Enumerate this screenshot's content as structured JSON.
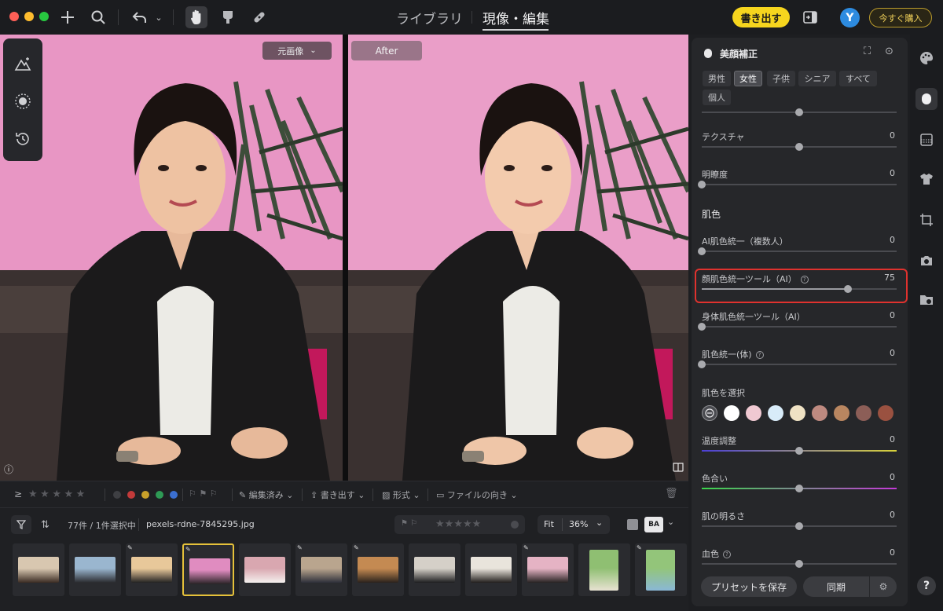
{
  "toolbar": {
    "tabs": [
      {
        "label": "ライブラリ",
        "active": false
      },
      {
        "label": "現像・編集",
        "active": true
      }
    ],
    "export_label": "書き出す",
    "avatar_initial": "Y",
    "buy_label": "今すぐ購入",
    "accent_color": "#f6d51e"
  },
  "viewer": {
    "before_label": "元画像",
    "after_label": "After"
  },
  "filmstrip": {
    "filter_items": {
      "edited": "編集済み",
      "export": "書き出す",
      "format": "形式",
      "orientation": "ファイルの向き"
    },
    "count_text": "77件 / 1件選択中",
    "filename": "pexels-rdne-7845295.jpg",
    "fit_label": "Fit",
    "zoom_value": "36%",
    "compare_label": "BA",
    "color_labels": [
      "#3e3f43",
      "#c23a3a",
      "#c8a02a",
      "#2e9a55",
      "#3b6fd0"
    ],
    "thumbnails": [
      {
        "colors": [
          "#d8c7b0",
          "#3a2b22"
        ],
        "portrait": false,
        "edited": false,
        "selected": false
      },
      {
        "colors": [
          "#9ab6cf",
          "#2a2a2e"
        ],
        "portrait": false,
        "edited": false,
        "selected": false
      },
      {
        "colors": [
          "#e8c89a",
          "#222"
        ],
        "portrait": false,
        "edited": true,
        "selected": false
      },
      {
        "colors": [
          "#e08cc0",
          "#262224"
        ],
        "portrait": false,
        "edited": true,
        "selected": true
      },
      {
        "colors": [
          "#d9a7b0",
          "#f4f0ee"
        ],
        "portrait": false,
        "edited": false,
        "selected": false
      },
      {
        "colors": [
          "#b9a58e",
          "#2d2f3a"
        ],
        "portrait": false,
        "edited": true,
        "selected": false
      },
      {
        "colors": [
          "#c48a52",
          "#2a221c"
        ],
        "portrait": false,
        "edited": true,
        "selected": false
      },
      {
        "colors": [
          "#d5d0c8",
          "#1d1d1f"
        ],
        "portrait": false,
        "edited": false,
        "selected": false
      },
      {
        "colors": [
          "#e9e4dc",
          "#211e1c"
        ],
        "portrait": false,
        "edited": false,
        "selected": false
      },
      {
        "colors": [
          "#e5b3c4",
          "#262222"
        ],
        "portrait": false,
        "edited": true,
        "selected": false
      },
      {
        "colors": [
          "#8fbf72",
          "#e8e2d2"
        ],
        "portrait": true,
        "edited": false,
        "selected": false
      },
      {
        "colors": [
          "#93c57a",
          "#8ab8d6"
        ],
        "portrait": true,
        "edited": true,
        "selected": false
      }
    ]
  },
  "panel": {
    "title": "美顔補正",
    "chips": [
      {
        "label": "男性",
        "active": false
      },
      {
        "label": "女性",
        "active": true
      },
      {
        "label": "子供",
        "active": false
      },
      {
        "label": "シニア",
        "active": false
      },
      {
        "label": "すべて",
        "active": false
      },
      {
        "label": "個人",
        "active": false
      }
    ],
    "top_slider_value": 50,
    "sliders_a": [
      {
        "label": "テクスチャ",
        "value": "0",
        "pos": 50
      },
      {
        "label": "明瞭度",
        "value": "0",
        "pos": 0
      }
    ],
    "skin_section": "肌色",
    "sliders_b": [
      {
        "label": "AI肌色統一（複数人）",
        "value": "0",
        "pos": 0
      },
      {
        "label": "顔肌色統一ツール（AI）",
        "value": "75",
        "pos": 75
      },
      {
        "label": "身体肌色統一ツール（AI）",
        "value": "0",
        "pos": 0
      },
      {
        "label": "肌色統一(体)",
        "value": "0",
        "pos": 0
      }
    ],
    "swatch_label": "肌色を選択",
    "swatches": [
      "#ffffff",
      "#f0c9d2",
      "#d8ecf9",
      "#efe2c4",
      "#be8a80",
      "#b98660",
      "#8c5e57",
      "#9a5140"
    ],
    "sliders_c": [
      {
        "label": "温度調整",
        "value": "0",
        "pos": 50
      },
      {
        "label": "色合い",
        "value": "0",
        "pos": 50
      },
      {
        "label": "肌の明るさ",
        "value": "0",
        "pos": 50
      },
      {
        "label": "血色",
        "value": "0",
        "pos": 50
      }
    ],
    "save_preset": "プリセットを保存",
    "sync": "同期"
  },
  "rail": {
    "help": "?"
  }
}
